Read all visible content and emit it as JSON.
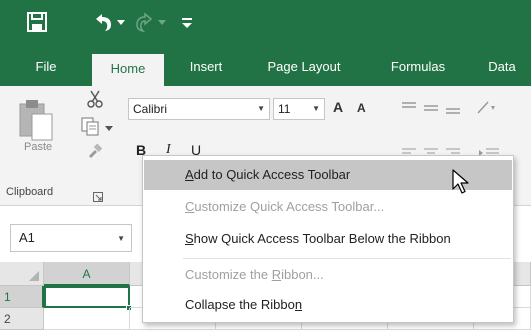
{
  "qat": {
    "save_icon": "save-icon",
    "undo_icon": "undo-icon",
    "redo_icon": "redo-icon",
    "customize_icon": "customize-qat-icon",
    "brand_color": "#217346"
  },
  "tabs": [
    {
      "label": "File"
    },
    {
      "label": "Home"
    },
    {
      "label": "Insert"
    },
    {
      "label": "Page Layout"
    },
    {
      "label": "Formulas"
    },
    {
      "label": "Data"
    }
  ],
  "ribbon": {
    "paste_label": "Paste",
    "clipboard_label": "Clipboard",
    "font_name": "Calibri",
    "font_size": "11",
    "bold": "B",
    "italic": "I",
    "underline": "U",
    "grow_font": "A",
    "shrink_font": "A"
  },
  "formula_bar": {
    "namebox_value": "A1"
  },
  "grid": {
    "columns": [
      "A"
    ],
    "rows": [
      "1",
      "2"
    ]
  },
  "context_menu": {
    "items": [
      {
        "pre": "",
        "u": "A",
        "post": "dd to Quick Access Toolbar"
      },
      {
        "pre": "",
        "u": "C",
        "post": "ustomize Quick Access Toolbar..."
      },
      {
        "pre": "",
        "u": "S",
        "post": "how Quick Access Toolbar Below the Ribbon"
      },
      {
        "pre": "Customize the ",
        "u": "R",
        "post": "ibbon..."
      },
      {
        "pre": "Collapse the Ribbo",
        "u": "n",
        "post": ""
      }
    ]
  }
}
